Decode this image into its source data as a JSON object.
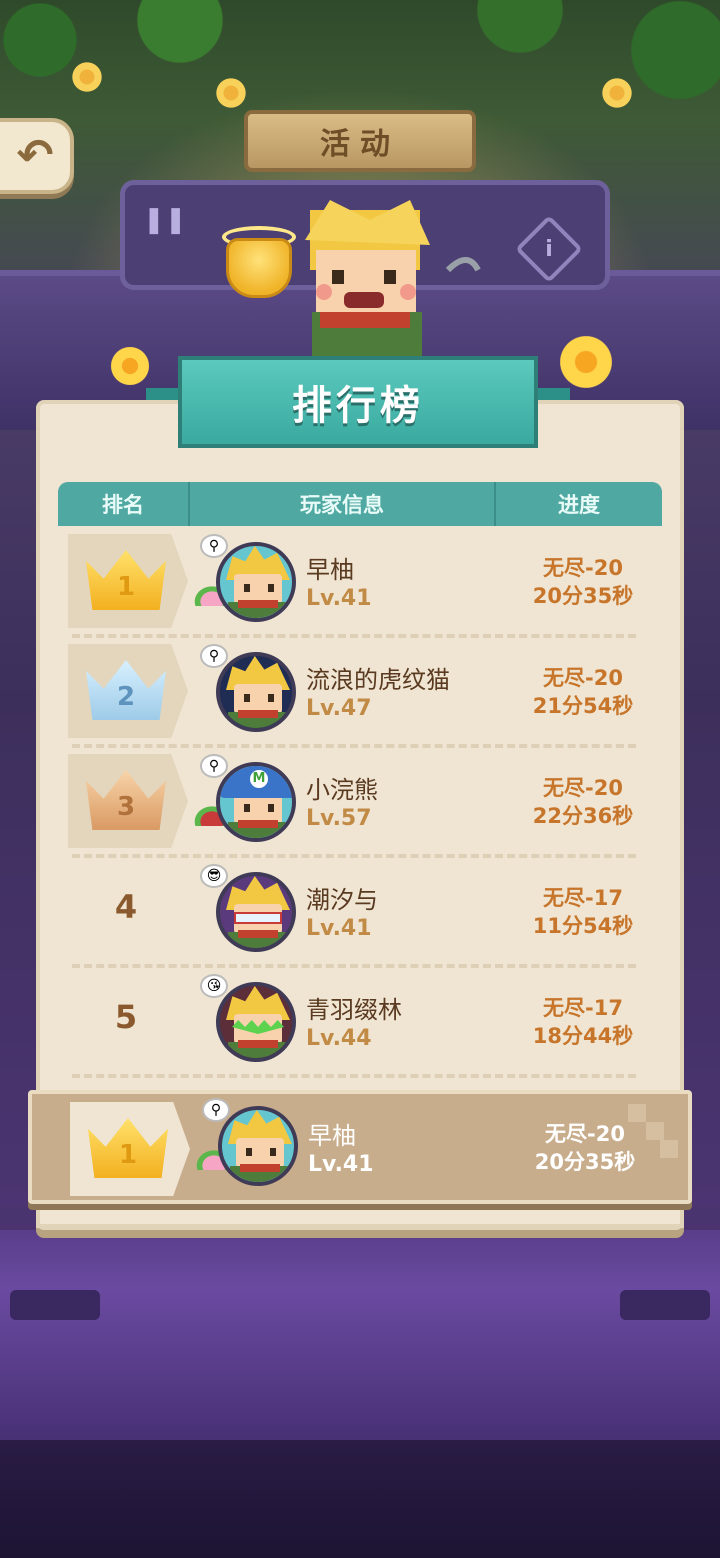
{
  "header": {
    "back_icon": "back-arrow-icon",
    "activity_label": "活动"
  },
  "banner": {
    "title": "排行榜"
  },
  "table": {
    "columns": [
      "排名",
      "玩家信息",
      "进度"
    ]
  },
  "rows": [
    {
      "rank": "1",
      "rank_badge": "gold-crown-icon",
      "name": "早柚",
      "level": "Lv.41",
      "stage": "无尽-20",
      "time": "20分35秒"
    },
    {
      "rank": "2",
      "rank_badge": "silver-crown-icon",
      "name": "流浪的虎纹猫",
      "level": "Lv.47",
      "stage": "无尽-20",
      "time": "21分54秒"
    },
    {
      "rank": "3",
      "rank_badge": "bronze-crown-icon",
      "name": "小浣熊",
      "level": "Lv.57",
      "stage": "无尽-20",
      "time": "22分36秒"
    },
    {
      "rank": "4",
      "rank_badge": "",
      "name": "潮汐与",
      "level": "Lv.41",
      "stage": "无尽-17",
      "time": "11分54秒"
    },
    {
      "rank": "5",
      "rank_badge": "",
      "name": "青羽缀林",
      "level": "Lv.44",
      "stage": "无尽-17",
      "time": "18分44秒"
    }
  ],
  "my_rank": {
    "rank": "1",
    "rank_badge": "gold-crown-icon",
    "name": "早柚",
    "level": "Lv.41",
    "stage": "无尽-20",
    "time": "20分35秒"
  },
  "colors": {
    "banner_teal": "#3aa99f",
    "header_teal": "#4fa8a1",
    "card_bg": "#efe5d2",
    "progress_text": "#c7752a",
    "my_rank_bg": "#c8ad8c"
  }
}
